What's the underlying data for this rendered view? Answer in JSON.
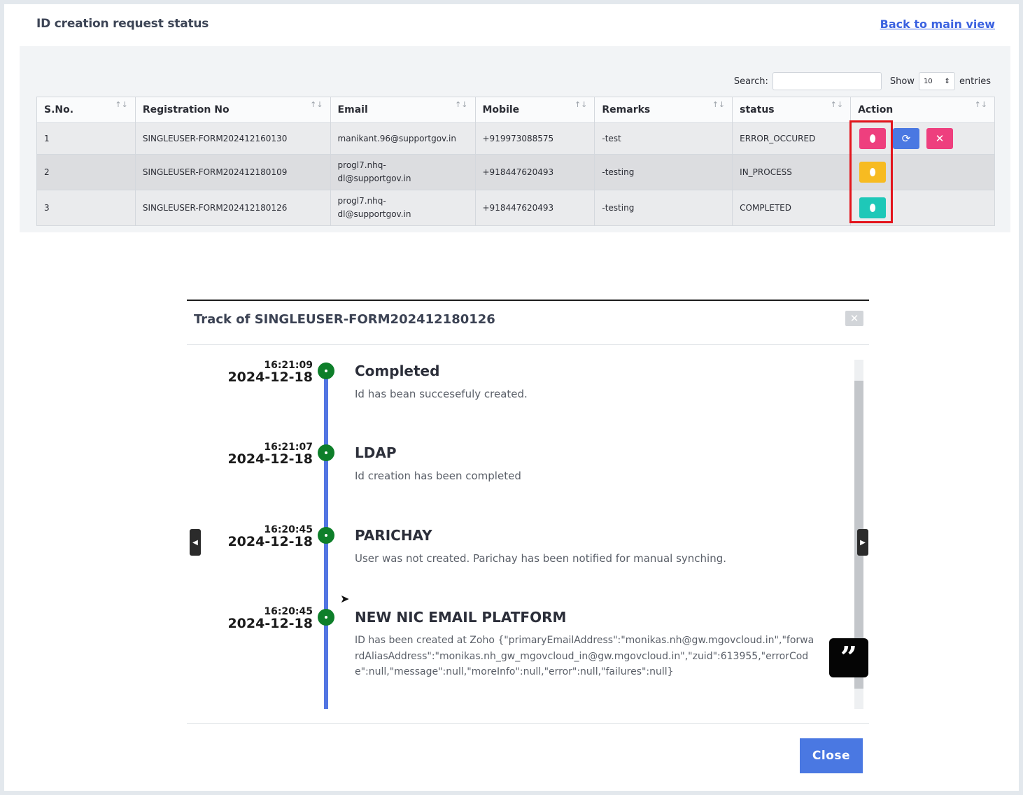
{
  "page": {
    "title": "ID creation request status",
    "back_link": "Back to main view"
  },
  "controls": {
    "search_label": "Search:",
    "search_value": "",
    "show_label": "Show",
    "entries_value": "10",
    "entries_label": "entries"
  },
  "table": {
    "columns": [
      "S.No.",
      "Registration No",
      "Email",
      "Mobile",
      "Remarks",
      "status",
      "Action"
    ],
    "sort_icon": "↑↓",
    "rows": [
      {
        "sno": "1",
        "registration_no": "SINGLEUSER-FORM202412160130",
        "email_line1": "manikant.96@supportgov.in",
        "email_line2": "",
        "mobile": "+919973088575",
        "remarks": "-test",
        "status": "ERROR_OCCURED",
        "actions": [
          "track-button",
          "retry-button",
          "delete-button"
        ]
      },
      {
        "sno": "2",
        "registration_no": "SINGLEUSER-FORM202412180109",
        "email_line1": "progl7.nhq-",
        "email_line2": "dl@supportgov.in",
        "mobile": "+918447620493",
        "remarks": "-testing",
        "status": "IN_PROCESS",
        "actions": [
          "track-button"
        ]
      },
      {
        "sno": "3",
        "registration_no": "SINGLEUSER-FORM202412180126",
        "email_line1": "progl7.nhq-",
        "email_line2": "dl@supportgov.in",
        "mobile": "+918447620493",
        "remarks": "-testing",
        "status": "COMPLETED",
        "actions": [
          "track-button"
        ]
      }
    ],
    "colors": {
      "error": "#ee3f7e",
      "retry": "#4a78e2",
      "in_process": "#f7bb21",
      "completed": "#1ec8b8",
      "highlight_border": "#e3141c"
    }
  },
  "modal": {
    "title": "Track of SINGLEUSER-FORM202412180126",
    "close_label": "Close",
    "events": [
      {
        "time": "16:21:09",
        "date": "2024-12-18",
        "title": "Completed",
        "description": "Id has bean succesefuly created."
      },
      {
        "time": "16:21:07",
        "date": "2024-12-18",
        "title": "LDAP",
        "description": "Id creation has been completed"
      },
      {
        "time": "16:20:45",
        "date": "2024-12-18",
        "title": "PARICHAY",
        "description": "User was not created. Parichay has been notified for manual synching."
      },
      {
        "time": "16:20:45",
        "date": "2024-12-18",
        "title": "NEW NIC EMAIL PLATFORM",
        "description": "ID has been created at Zoho {\"primaryEmailAddress\":\"monikas.nh@gw.mgovcloud.in\",\"forwardAliasAddress\":\"monikas.nh_gw_mgovcloud_in@gw.mgovcloud.in\",\"zuid\":613955,\"errorCode\":null,\"message\":null,\"moreInfo\":null,\"error\":null,\"failures\":null}"
      }
    ],
    "timeline_color": "#5275e2",
    "dot_color": "#0e7f2a"
  },
  "icons": {
    "track": "map-pin-icon",
    "retry": "refresh-icon",
    "delete": "close-icon",
    "quote": "quote-icon"
  }
}
